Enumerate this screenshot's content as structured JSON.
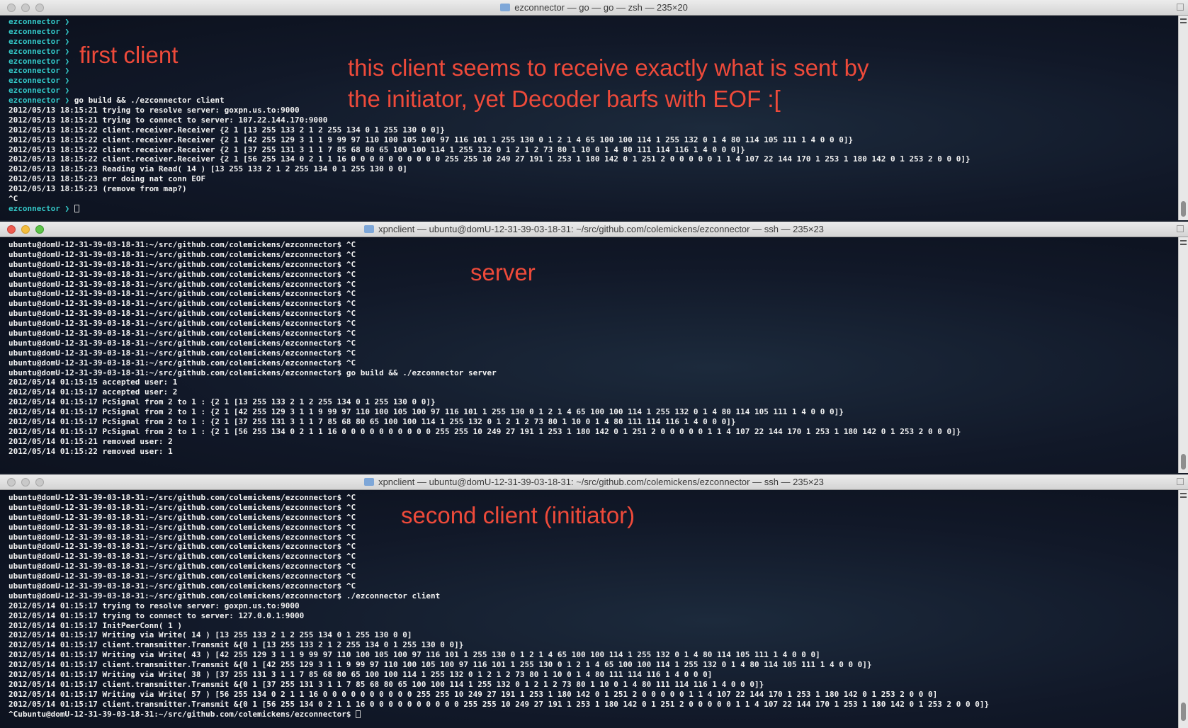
{
  "windows": [
    {
      "title": "ezconnector — go — go — zsh — 235×20",
      "active": false,
      "prompt_lines": [
        {
          "prompt": "ezconnector ❯",
          "cmd": ""
        },
        {
          "prompt": "ezconnector ❯",
          "cmd": ""
        },
        {
          "prompt": "ezconnector ❯",
          "cmd": ""
        },
        {
          "prompt": "ezconnector ❯",
          "cmd": ""
        },
        {
          "prompt": "ezconnector ❯",
          "cmd": ""
        },
        {
          "prompt": "ezconnector ❯",
          "cmd": ""
        },
        {
          "prompt": "ezconnector ❯",
          "cmd": ""
        },
        {
          "prompt": "ezconnector ❯",
          "cmd": ""
        },
        {
          "prompt": "ezconnector ❯",
          "cmd": " go build && ./ezconnector client"
        }
      ],
      "output": [
        "2012/05/13 18:15:21 trying to resolve server: goxpn.us.to:9000",
        "2012/05/13 18:15:21 trying to connect to server: 107.22.144.170:9000",
        "2012/05/13 18:15:22 client.receiver.Receiver {2 1 [13 255 133 2 1 2 255 134 0 1 255 130 0 0]}",
        "2012/05/13 18:15:22 client.receiver.Receiver {2 1 [42 255 129 3 1 1 9 99 97 110 100 105 100 97 116 101 1 255 130 0 1 2 1 4 65 100 100 114 1 255 132 0 1 4 80 114 105 111 1 4 0 0 0]}",
        "2012/05/13 18:15:22 client.receiver.Receiver {2 1 [37 255 131 3 1 1 7 85 68 80 65 100 100 114 1 255 132 0 1 2 1 2 73 80 1 10 0 1 4 80 111 114 116 1 4 0 0 0]}",
        "2012/05/13 18:15:22 client.receiver.Receiver {2 1 [56 255 134 0 2 1 1 16 0 0 0 0 0 0 0 0 0 0 255 255 10 249 27 191 1 253 1 180 142 0 1 251 2 0 0 0 0 0 1 1 4 107 22 144 170 1 253 1 180 142 0 1 253 2 0 0 0]}",
        "2012/05/13 18:15:23 Reading via Read( 14 ) [13 255 133 2 1 2 255 134 0 1 255 130 0 0]",
        "2012/05/13 18:15:23 err doing nat conn EOF",
        "2012/05/13 18:15:23 (remove from map?)",
        "^C"
      ],
      "final_prompt": "ezconnector ❯",
      "annotations": [
        "first client",
        "this client seems to receive exactly what is sent by",
        "the initiator, yet Decoder barfs with EOF :["
      ]
    },
    {
      "title": "xpnclient — ubuntu@domU-12-31-39-03-18-31: ~/src/github.com/colemickens/ezconnector — ssh — 235×23",
      "active": true,
      "lines": [
        "ubuntu@domU-12-31-39-03-18-31:~/src/github.com/colemickens/ezconnector$ ^C",
        "ubuntu@domU-12-31-39-03-18-31:~/src/github.com/colemickens/ezconnector$ ^C",
        "ubuntu@domU-12-31-39-03-18-31:~/src/github.com/colemickens/ezconnector$ ^C",
        "ubuntu@domU-12-31-39-03-18-31:~/src/github.com/colemickens/ezconnector$ ^C",
        "ubuntu@domU-12-31-39-03-18-31:~/src/github.com/colemickens/ezconnector$ ^C",
        "ubuntu@domU-12-31-39-03-18-31:~/src/github.com/colemickens/ezconnector$ ^C",
        "ubuntu@domU-12-31-39-03-18-31:~/src/github.com/colemickens/ezconnector$ ^C",
        "ubuntu@domU-12-31-39-03-18-31:~/src/github.com/colemickens/ezconnector$ ^C",
        "ubuntu@domU-12-31-39-03-18-31:~/src/github.com/colemickens/ezconnector$ ^C",
        "ubuntu@domU-12-31-39-03-18-31:~/src/github.com/colemickens/ezconnector$ ^C",
        "ubuntu@domU-12-31-39-03-18-31:~/src/github.com/colemickens/ezconnector$ ^C",
        "ubuntu@domU-12-31-39-03-18-31:~/src/github.com/colemickens/ezconnector$ ^C",
        "ubuntu@domU-12-31-39-03-18-31:~/src/github.com/colemickens/ezconnector$ ^C",
        "ubuntu@domU-12-31-39-03-18-31:~/src/github.com/colemickens/ezconnector$ go build && ./ezconnector server",
        "2012/05/14 01:15:15 accepted user: 1",
        "2012/05/14 01:15:17 accepted user: 2",
        "2012/05/14 01:15:17 PcSignal from 2 to 1 : {2 1 [13 255 133 2 1 2 255 134 0 1 255 130 0 0]}",
        "2012/05/14 01:15:17 PcSignal from 2 to 1 : {2 1 [42 255 129 3 1 1 9 99 97 110 100 105 100 97 116 101 1 255 130 0 1 2 1 4 65 100 100 114 1 255 132 0 1 4 80 114 105 111 1 4 0 0 0]}",
        "2012/05/14 01:15:17 PcSignal from 2 to 1 : {2 1 [37 255 131 3 1 1 7 85 68 80 65 100 100 114 1 255 132 0 1 2 1 2 73 80 1 10 0 1 4 80 111 114 116 1 4 0 0 0]}",
        "2012/05/14 01:15:17 PcSignal from 2 to 1 : {2 1 [56 255 134 0 2 1 1 16 0 0 0 0 0 0 0 0 0 0 255 255 10 249 27 191 1 253 1 180 142 0 1 251 2 0 0 0 0 0 1 1 4 107 22 144 170 1 253 1 180 142 0 1 253 2 0 0 0]}",
        "2012/05/14 01:15:21 removed user: 2",
        "2012/05/14 01:15:22 removed user: 1"
      ],
      "annotations": [
        "server"
      ]
    },
    {
      "title": "xpnclient — ubuntu@domU-12-31-39-03-18-31: ~/src/github.com/colemickens/ezconnector — ssh — 235×23",
      "active": false,
      "lines": [
        "ubuntu@domU-12-31-39-03-18-31:~/src/github.com/colemickens/ezconnector$ ^C",
        "ubuntu@domU-12-31-39-03-18-31:~/src/github.com/colemickens/ezconnector$ ^C",
        "ubuntu@domU-12-31-39-03-18-31:~/src/github.com/colemickens/ezconnector$ ^C",
        "ubuntu@domU-12-31-39-03-18-31:~/src/github.com/colemickens/ezconnector$ ^C",
        "ubuntu@domU-12-31-39-03-18-31:~/src/github.com/colemickens/ezconnector$ ^C",
        "ubuntu@domU-12-31-39-03-18-31:~/src/github.com/colemickens/ezconnector$ ^C",
        "ubuntu@domU-12-31-39-03-18-31:~/src/github.com/colemickens/ezconnector$ ^C",
        "ubuntu@domU-12-31-39-03-18-31:~/src/github.com/colemickens/ezconnector$ ^C",
        "ubuntu@domU-12-31-39-03-18-31:~/src/github.com/colemickens/ezconnector$ ^C",
        "ubuntu@domU-12-31-39-03-18-31:~/src/github.com/colemickens/ezconnector$ ^C",
        "ubuntu@domU-12-31-39-03-18-31:~/src/github.com/colemickens/ezconnector$ ./ezconnector client",
        "2012/05/14 01:15:17 trying to resolve server: goxpn.us.to:9000",
        "2012/05/14 01:15:17 trying to connect to server: 127.0.0.1:9000",
        "2012/05/14 01:15:17 InitPeerConn( 1 )",
        "2012/05/14 01:15:17 Writing via Write( 14 ) [13 255 133 2 1 2 255 134 0 1 255 130 0 0]",
        "2012/05/14 01:15:17 client.transmitter.Transmit &{0 1 [13 255 133 2 1 2 255 134 0 1 255 130 0 0]}",
        "2012/05/14 01:15:17 Writing via Write( 43 ) [42 255 129 3 1 1 9 99 97 110 100 105 100 97 116 101 1 255 130 0 1 2 1 4 65 100 100 114 1 255 132 0 1 4 80 114 105 111 1 4 0 0 0]",
        "2012/05/14 01:15:17 client.transmitter.Transmit &{0 1 [42 255 129 3 1 1 9 99 97 110 100 105 100 97 116 101 1 255 130 0 1 2 1 4 65 100 100 114 1 255 132 0 1 4 80 114 105 111 1 4 0 0 0]}",
        "2012/05/14 01:15:17 Writing via Write( 38 ) [37 255 131 3 1 1 7 85 68 80 65 100 100 114 1 255 132 0 1 2 1 2 73 80 1 10 0 1 4 80 111 114 116 1 4 0 0 0]",
        "2012/05/14 01:15:17 client.transmitter.Transmit &{0 1 [37 255 131 3 1 1 7 85 68 80 65 100 100 114 1 255 132 0 1 2 1 2 73 80 1 10 0 1 4 80 111 114 116 1 4 0 0 0]}",
        "2012/05/14 01:15:17 Writing via Write( 57 ) [56 255 134 0 2 1 1 16 0 0 0 0 0 0 0 0 0 0 255 255 10 249 27 191 1 253 1 180 142 0 1 251 2 0 0 0 0 0 1 1 4 107 22 144 170 1 253 1 180 142 0 1 253 2 0 0 0]",
        "2012/05/14 01:15:17 client.transmitter.Transmit &{0 1 [56 255 134 0 2 1 1 16 0 0 0 0 0 0 0 0 0 0 255 255 10 249 27 191 1 253 1 180 142 0 1 251 2 0 0 0 0 0 1 1 4 107 22 144 170 1 253 1 180 142 0 1 253 2 0 0 0]}",
        "^Cubuntu@domU-12-31-39-03-18-31:~/src/github.com/colemickens/ezconnector$ "
      ],
      "annotations": [
        "second client (initiator)"
      ]
    }
  ],
  "colors": {
    "annotation": "#ee4a3a",
    "prompt": "#33c7c7",
    "text": "#f2f2f2"
  }
}
